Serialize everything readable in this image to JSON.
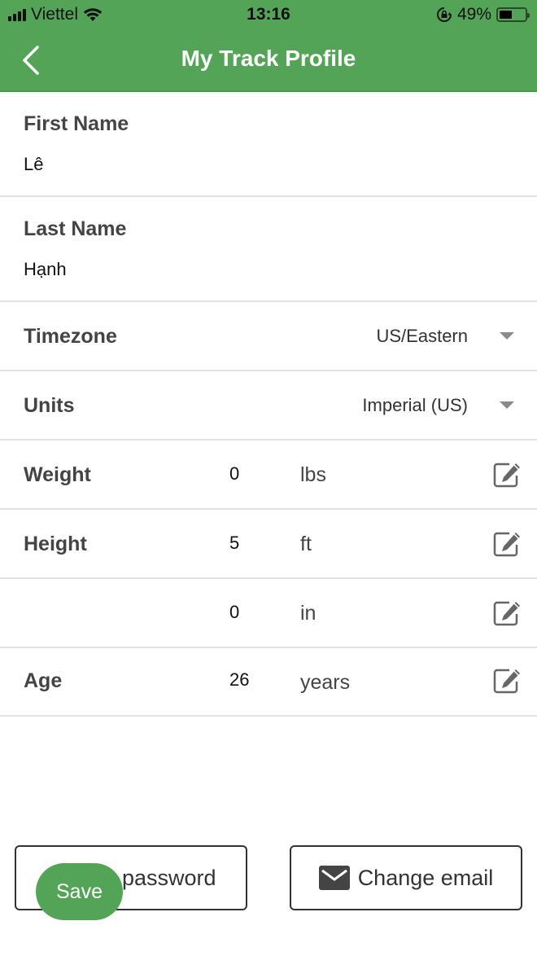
{
  "status_bar": {
    "carrier": "Viettel",
    "time": "13:16",
    "battery_percent_label": "49%",
    "battery_level": 0.49
  },
  "header": {
    "title": "My Track Profile",
    "back_icon": "chevron-left-icon"
  },
  "fields": {
    "first_name": {
      "label": "First Name",
      "value": "Lê"
    },
    "last_name": {
      "label": "Last Name",
      "value": "Hạnh"
    },
    "timezone": {
      "label": "Timezone",
      "value": "US/Eastern"
    },
    "units": {
      "label": "Units",
      "value": "Imperial (US)"
    },
    "weight": {
      "label": "Weight",
      "value": "0",
      "unit": "lbs"
    },
    "height_ft": {
      "label": "Height",
      "value": "5",
      "unit": "ft"
    },
    "height_in": {
      "label": "",
      "value": "0",
      "unit": "in"
    },
    "age": {
      "label": "Age",
      "value": "26",
      "unit": "years"
    }
  },
  "buttons": {
    "password_label": "password",
    "email_label": "Change email",
    "save_label": "Save"
  },
  "colors": {
    "brand_green": "#54a457"
  }
}
